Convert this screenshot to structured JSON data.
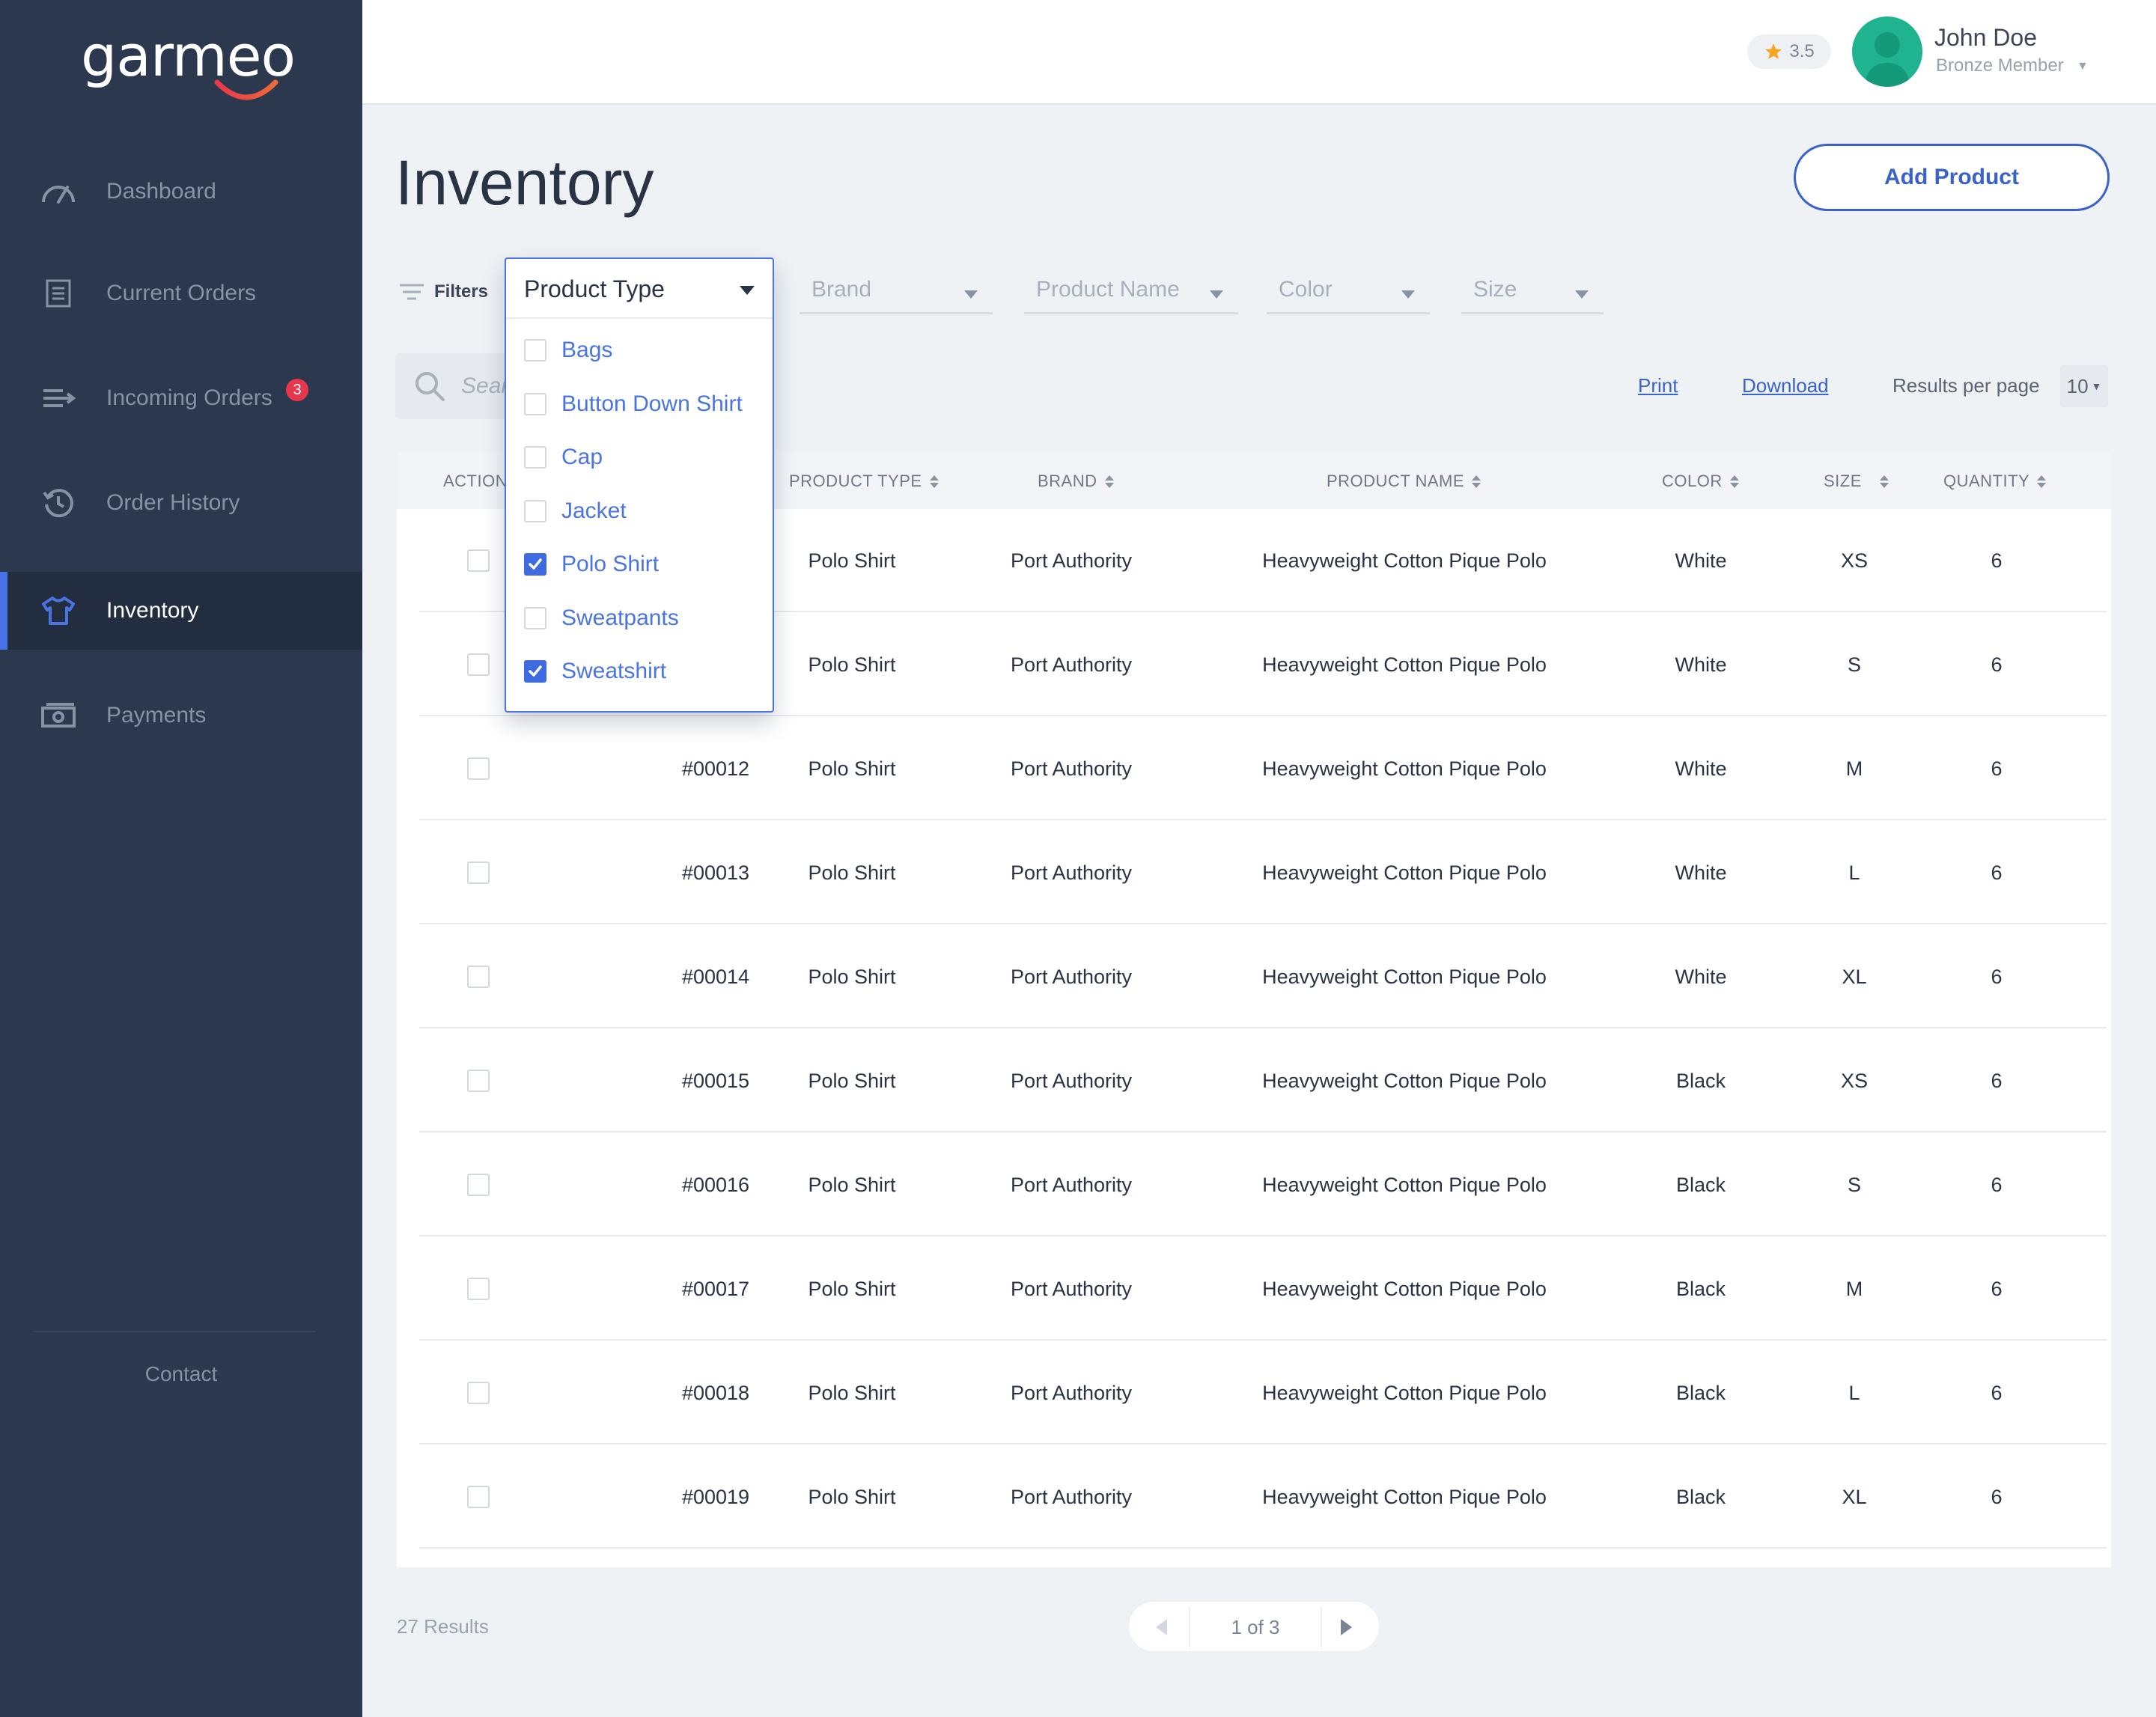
{
  "brand": {
    "logo_text": "garmeo"
  },
  "sidebar": {
    "items": [
      {
        "label": "Dashboard",
        "icon": "gauge-icon"
      },
      {
        "label": "Current Orders",
        "icon": "list-icon"
      },
      {
        "label": "Incoming Orders",
        "icon": "incoming-icon",
        "badge": "3"
      },
      {
        "label": "Order History",
        "icon": "history-icon"
      },
      {
        "label": "Inventory",
        "icon": "tshirt-icon",
        "active": true
      },
      {
        "label": "Payments",
        "icon": "cash-icon"
      }
    ],
    "contact_label": "Contact"
  },
  "topbar": {
    "rating": "3.5",
    "user_name": "John Doe",
    "user_tier": "Bronze Member"
  },
  "page": {
    "title": "Inventory",
    "add_button": "Add Product"
  },
  "filters": {
    "label": "Filters",
    "selects": [
      "Brand",
      "Product Name",
      "Color",
      "Size"
    ],
    "product_type": {
      "title": "Product Type",
      "options": [
        {
          "label": "Bags",
          "checked": false
        },
        {
          "label": "Button Down Shirt",
          "checked": false
        },
        {
          "label": "Cap",
          "checked": false
        },
        {
          "label": "Jacket",
          "checked": false
        },
        {
          "label": "Polo Shirt",
          "checked": true
        },
        {
          "label": "Sweatpants",
          "checked": false
        },
        {
          "label": "Sweatshirt",
          "checked": true
        }
      ]
    }
  },
  "toolbar": {
    "search_placeholder": "Search",
    "print": "Print",
    "download": "Download",
    "results_per_page_label": "Results per page",
    "results_per_page_value": "10"
  },
  "table": {
    "headers": [
      "ACTION",
      "PRODUCT TYPE",
      "BRAND",
      "PRODUCT NAME",
      "COLOR",
      "SIZE",
      "QUANTITY"
    ],
    "rows": [
      {
        "id": "",
        "type": "Polo Shirt",
        "brand": "Port Authority",
        "name": "Heavyweight Cotton Pique Polo",
        "color": "White",
        "size": "XS",
        "qty": "6"
      },
      {
        "id": "",
        "type": "Polo Shirt",
        "brand": "Port Authority",
        "name": "Heavyweight Cotton Pique Polo",
        "color": "White",
        "size": "S",
        "qty": "6"
      },
      {
        "id": "#00012",
        "type": "Polo Shirt",
        "brand": "Port Authority",
        "name": "Heavyweight Cotton Pique Polo",
        "color": "White",
        "size": "M",
        "qty": "6"
      },
      {
        "id": "#00013",
        "type": "Polo Shirt",
        "brand": "Port Authority",
        "name": "Heavyweight Cotton Pique Polo",
        "color": "White",
        "size": "L",
        "qty": "6"
      },
      {
        "id": "#00014",
        "type": "Polo Shirt",
        "brand": "Port Authority",
        "name": "Heavyweight Cotton Pique Polo",
        "color": "White",
        "size": "XL",
        "qty": "6"
      },
      {
        "id": "#00015",
        "type": "Polo Shirt",
        "brand": "Port Authority",
        "name": "Heavyweight Cotton Pique Polo",
        "color": "Black",
        "size": "XS",
        "qty": "6"
      },
      {
        "id": "#00016",
        "type": "Polo Shirt",
        "brand": "Port Authority",
        "name": "Heavyweight Cotton Pique Polo",
        "color": "Black",
        "size": "S",
        "qty": "6"
      },
      {
        "id": "#00017",
        "type": "Polo Shirt",
        "brand": "Port Authority",
        "name": "Heavyweight Cotton Pique Polo",
        "color": "Black",
        "size": "M",
        "qty": "6"
      },
      {
        "id": "#00018",
        "type": "Polo Shirt",
        "brand": "Port Authority",
        "name": "Heavyweight Cotton Pique Polo",
        "color": "Black",
        "size": "L",
        "qty": "6"
      },
      {
        "id": "#00019",
        "type": "Polo Shirt",
        "brand": "Port Authority",
        "name": "Heavyweight Cotton Pique Polo",
        "color": "Black",
        "size": "XL",
        "qty": "6"
      }
    ]
  },
  "footer": {
    "results": "27 Results",
    "page_text": "1 of 3"
  },
  "colors": {
    "sidebar_bg": "#2b384e",
    "accent_blue": "#3a62c8",
    "avatar_green": "#1fb38f",
    "badge_red": "#e8364d",
    "star_orange": "#f5a623"
  }
}
